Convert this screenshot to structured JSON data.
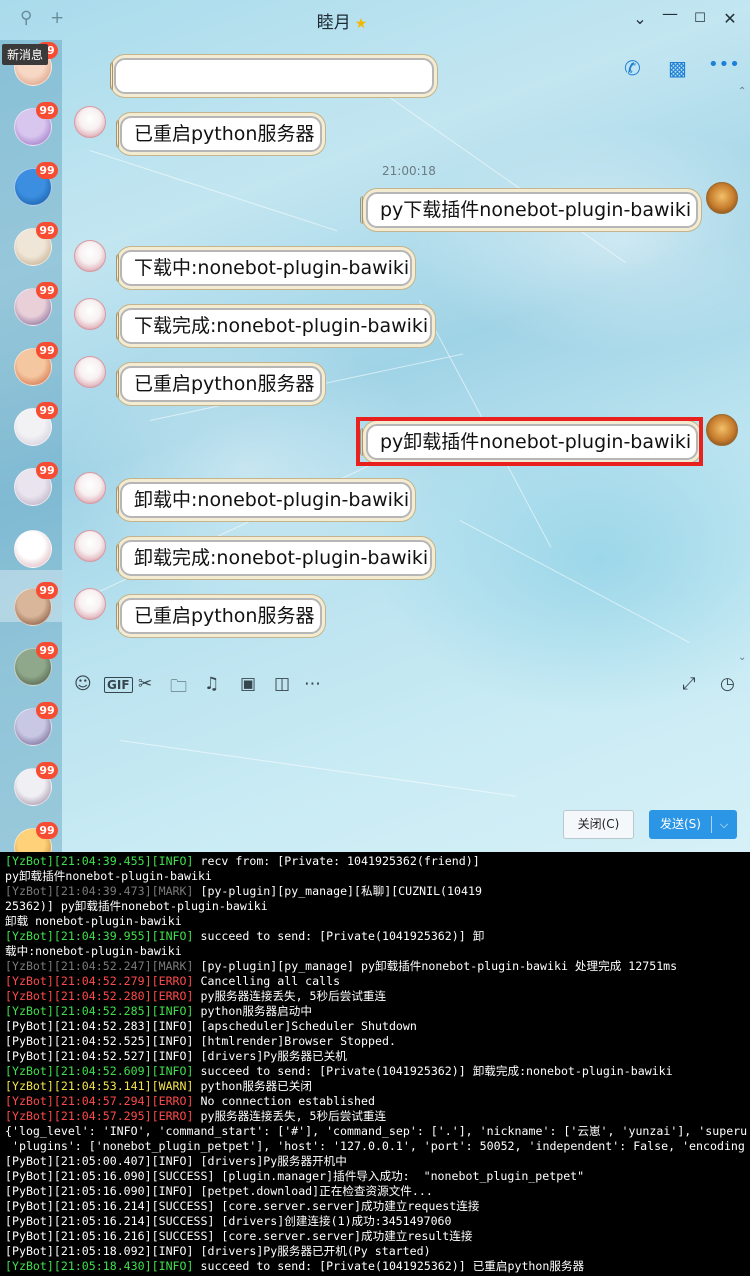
{
  "window": {
    "title": "睦月",
    "title_badge_icon": "star-badge-icon",
    "controls": [
      "chevron-down-icon",
      "minimize-icon",
      "maximize-icon",
      "close-icon"
    ]
  },
  "sidebar": {
    "new_message_label": "新消息",
    "contacts": [
      {
        "badge": "99"
      },
      {
        "badge": "99"
      },
      {
        "badge": "99"
      },
      {
        "badge": "99"
      },
      {
        "badge": "99"
      },
      {
        "badge": "99"
      },
      {
        "badge": "99"
      },
      {
        "badge": "99"
      },
      {
        "badge": ""
      },
      {
        "badge": "99"
      },
      {
        "badge": "99"
      },
      {
        "badge": "99"
      },
      {
        "badge": "99"
      },
      {
        "badge": "99"
      }
    ]
  },
  "chat": {
    "header_icons": [
      "phone-icon",
      "video-call-icon",
      "more-icon"
    ],
    "timestamp": "21:00:18",
    "messages": [
      {
        "side": "left",
        "text": "已重启python服务器"
      },
      {
        "side": "right",
        "text": "py下载插件nonebot-plugin-bawiki"
      },
      {
        "side": "left",
        "text": "下载中:nonebot-plugin-bawiki"
      },
      {
        "side": "left",
        "text": "下载完成:nonebot-plugin-bawiki"
      },
      {
        "side": "left",
        "text": "已重启python服务器"
      },
      {
        "side": "right",
        "text": "py卸载插件nonebot-plugin-bawiki"
      },
      {
        "side": "left",
        "text": "卸载中:nonebot-plugin-bawiki"
      },
      {
        "side": "left",
        "text": "卸载完成:nonebot-plugin-bawiki"
      },
      {
        "side": "left",
        "text": "已重启python服务器"
      }
    ]
  },
  "toolbar": {
    "icons": [
      "emoji-icon",
      "gif-icon",
      "scissors-icon",
      "folder-icon",
      "music-icon",
      "image-icon",
      "shake-icon",
      "more-icon",
      "expand-icon",
      "history-icon"
    ],
    "close_label": "关闭(C)",
    "send_label": "发送(S)"
  },
  "console": {
    "lines": [
      {
        "tag": "[YzBot]",
        "time": "[21:04:39.455]",
        "level": "[INFO]",
        "text": " recv from: [Private: 1041925362(friend)]"
      },
      {
        "tag": "",
        "time": "",
        "level": "",
        "text": "py卸载插件nonebot-plugin-bawiki"
      },
      {
        "tag": "[YzBot]",
        "time": "[21:04:39.473]",
        "level": "[MARK]",
        "text": " [py-plugin][py_manage][私聊][CUZNIL(10419"
      },
      {
        "tag": "",
        "time": "",
        "level": "",
        "text": "25362)] py卸载插件nonebot-plugin-bawiki"
      },
      {
        "tag": "",
        "time": "",
        "level": "",
        "text": "卸载 nonebot-plugin-bawiki"
      },
      {
        "tag": "[YzBot]",
        "time": "[21:04:39.955]",
        "level": "[INFO]",
        "text": " succeed to send: [Private(1041925362)] 卸"
      },
      {
        "tag": "",
        "time": "",
        "level": "",
        "text": "载中:nonebot-plugin-bawiki"
      },
      {
        "tag": "[YzBot]",
        "time": "[21:04:52.247]",
        "level": "[MARK]",
        "text": " [py-plugin][py_manage] py卸载插件nonebot-plugin-bawiki 处理完成 12751ms"
      },
      {
        "tag": "[YzBot]",
        "time": "[21:04:52.279]",
        "level": "[ERRO]",
        "text": " Cancelling all calls"
      },
      {
        "tag": "[YzBot]",
        "time": "[21:04:52.280]",
        "level": "[ERRO]",
        "text": " py服务器连接丢失, 5秒后尝试重连"
      },
      {
        "tag": "[YzBot]",
        "time": "[21:04:52.285]",
        "level": "[INFO]",
        "text": " python服务器启动中"
      },
      {
        "tag": "[PyBot]",
        "time": "[21:04:52.283]",
        "level": "[INFO]",
        "text": " [apscheduler]Scheduler Shutdown"
      },
      {
        "tag": "[PyBot]",
        "time": "[21:04:52.525]",
        "level": "[INFO]",
        "text": " [htmlrender]Browser Stopped."
      },
      {
        "tag": "[PyBot]",
        "time": "[21:04:52.527]",
        "level": "[INFO]",
        "text": " [drivers]Py服务器已关机"
      },
      {
        "tag": "[YzBot]",
        "time": "[21:04:52.609]",
        "level": "[INFO]",
        "text": " succeed to send: [Private(1041925362)] 卸载完成:nonebot-plugin-bawiki"
      },
      {
        "tag": "[YzBot]",
        "time": "[21:04:53.141]",
        "level": "[WARN]",
        "text": " python服务器已关闭"
      },
      {
        "tag": "[YzBot]",
        "time": "[21:04:57.294]",
        "level": "[ERRO]",
        "text": " No connection established"
      },
      {
        "tag": "[YzBot]",
        "time": "[21:04:57.295]",
        "level": "[ERRO]",
        "text": " py服务器连接丢失, 5秒后尝试重连"
      },
      {
        "tag": "",
        "time": "",
        "level": "",
        "text": "{'log_level': 'INFO', 'command_start': ['#'], 'command_sep': ['.'], 'nickname': ['云崽', 'yunzai'], 'superu"
      },
      {
        "tag": "",
        "time": "",
        "level": "",
        "text": " 'plugins': ['nonebot_plugin_petpet'], 'host': '127.0.0.1', 'port': 50052, 'independent': False, 'encoding"
      },
      {
        "tag": "[PyBot]",
        "time": "[21:05:00.407]",
        "level": "[INFO]",
        "text": " [drivers]Py服务器开机中"
      },
      {
        "tag": "[PyBot]",
        "time": "[21:05:16.090]",
        "level": "[SUCCESS]",
        "text": " [plugin.manager]插件导入成功:  \"nonebot_plugin_petpet\""
      },
      {
        "tag": "[PyBot]",
        "time": "[21:05:16.090]",
        "level": "[INFO]",
        "text": " [petpet.download]正在检查资源文件..."
      },
      {
        "tag": "[PyBot]",
        "time": "[21:05:16.214]",
        "level": "[SUCCESS]",
        "text": " [core.server.server]成功建立request连接"
      },
      {
        "tag": "[PyBot]",
        "time": "[21:05:16.214]",
        "level": "[SUCCESS]",
        "text": " [drivers]创建连接(1)成功:3451497060"
      },
      {
        "tag": "[PyBot]",
        "time": "[21:05:16.216]",
        "level": "[SUCCESS]",
        "text": " [core.server.server]成功建立result连接"
      },
      {
        "tag": "[PyBot]",
        "time": "[21:05:18.092]",
        "level": "[INFO]",
        "text": " [drivers]Py服务器已开机(Py started)"
      },
      {
        "tag": "[YzBot]",
        "time": "[21:05:18.430]",
        "level": "[INFO]",
        "text": " succeed to send: [Private(1041925362)] 已重启python服务器"
      }
    ]
  }
}
